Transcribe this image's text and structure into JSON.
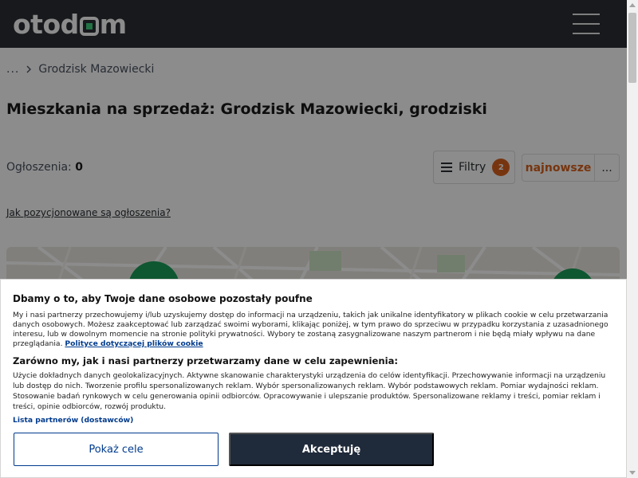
{
  "header": {
    "logo_text_left": "otod",
    "logo_text_right": "m",
    "menu_icon": "hamburger-icon"
  },
  "breadcrumb": {
    "ellipsis": "...",
    "separator_icon": "chevron-right-icon",
    "current": "Grodzisk Mazowiecki"
  },
  "main": {
    "title": "Mieszkania na sprzedaż: Grodzisk Mazowiecki, grodziski",
    "count_label": "Ogłoszenia:",
    "count_value": "0",
    "filters_label": "Filtry",
    "filters_badge": "2",
    "sort_label": "najnowsze",
    "more_label": "...",
    "info_link": "Jak pozycjonowane są ogłoszenia?"
  },
  "cookie": {
    "title": "Dbamy o to, aby Twoje dane osobowe pozostały poufne",
    "paragraph1": "My i nasi partnerzy przechowujemy i/lub uzyskujemy dostęp do informacji na urządzeniu, takich jak unikalne identyfikatory w plikach cookie w celu przetwarzania danych osobowych. Możesz zaakceptować lub zarządzać swoimi wyborami, klikając poniżej, w tym prawo do sprzeciwu w przypadku korzystania z uzasadnionego interesu, lub w dowolnym momencie na stronie polityki prywatności. Wybory te zostaną zasygnalizowane naszym partnerom i nie będą miały wpływu na dane przeglądania.",
    "policy_link": "Polityce dotyczącej plików cookie",
    "subtitle": "Zarówno my, jak i nasi partnerzy przetwarzamy dane w celu zapewnienia:",
    "paragraph2": "Użycie dokładnych danych geolokalizacyjnych. Aktywne skanowanie charakterystyki urządzenia do celów identyfikacji. Przechowywanie informacji na urządzeniu lub dostęp do nich. Tworzenie profilu spersonalizowanych reklam. Wybór spersonalizowanych reklam. Wybór podstawowych reklam. Pomiar wydajności reklam. Stosowanie badań rynkowych w celu generowania opinii odbiorców. Opracowywanie i ulepszanie produktów. Spersonalizowane reklamy i treści, pomiar reklam i treści, opinie odbiorców, rozwój produktu.",
    "partners_link": "Lista partnerów (dostawców)",
    "show_purposes": "Pokaż cele",
    "accept": "Akceptuję"
  },
  "colors": {
    "header_bg": "#2b2f33",
    "accent_orange": "#d9621d",
    "logo_green": "#3ecf7c",
    "link_blue": "#003b8e",
    "accept_bg": "#1f2a3a"
  }
}
